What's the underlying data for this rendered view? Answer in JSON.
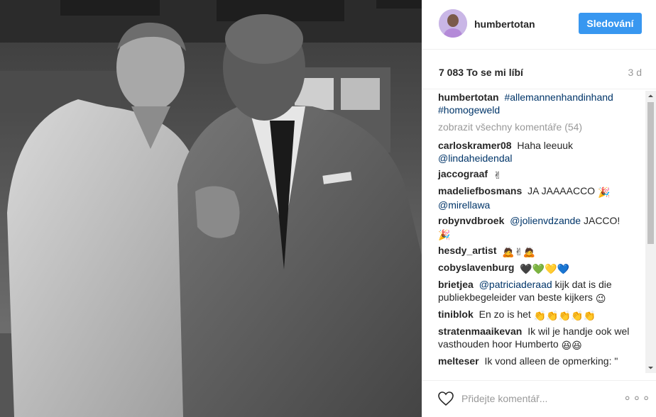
{
  "post": {
    "username": "humbertotan",
    "follow_label": "Sledování",
    "likes_count": "7 083",
    "likes_label": "To se mi líbí",
    "time_ago": "3 d"
  },
  "caption": {
    "user": "humbertotan",
    "hashtags": [
      "#allemannenhandinhand",
      "#homogeweld"
    ]
  },
  "view_all_comments": "zobrazit všechny komentáře (54)",
  "comments": [
    {
      "user": "carloskramer08",
      "text": "Haha leeuuk",
      "mention": "@lindaheidendal",
      "after": "",
      "emoji": ""
    },
    {
      "user": "jaccograaf",
      "text": "",
      "mention": "",
      "after": "",
      "emoji": "✌"
    },
    {
      "user": "madeliefbosmans",
      "text": "JA JAAAACCO",
      "mention": "@mirellawa",
      "after": "",
      "emoji": "🎉"
    },
    {
      "user": "robynvdbroek",
      "text": "",
      "mention": "@jolienvdzande",
      "after": "JACCO!",
      "emoji": "🎉"
    },
    {
      "user": "hesdy_artist",
      "text": "",
      "mention": "",
      "after": "",
      "emoji": "🙇✌🙇"
    },
    {
      "user": "cobyslavenburg",
      "text": "",
      "mention": "",
      "after": "",
      "emoji": "🖤💚💛💙"
    },
    {
      "user": "brietjea",
      "text": "",
      "mention": "@patriciaderaad",
      "after": "kijk dat is die publiekbegeleider van beste kijkers",
      "emoji": "😉"
    },
    {
      "user": "tiniblok",
      "text": "En zo is het",
      "mention": "",
      "after": "",
      "emoji": "👏👏👏👏👏"
    },
    {
      "user": "stratenmaaikevan",
      "text": "Ik wil je handje ook wel vasthouden hoor Humberto",
      "mention": "",
      "after": "",
      "emoji": "😆😆"
    },
    {
      "user": "melteser",
      "text": "Ik vond alleen de opmerking: \"",
      "mention": "",
      "after": "",
      "emoji": ""
    }
  ],
  "footer": {
    "comment_placeholder": "Přidejte komentář...",
    "more_label": "∘∘∘"
  },
  "colors": {
    "accent": "#3897f0",
    "link": "#003569",
    "muted": "#999999"
  }
}
